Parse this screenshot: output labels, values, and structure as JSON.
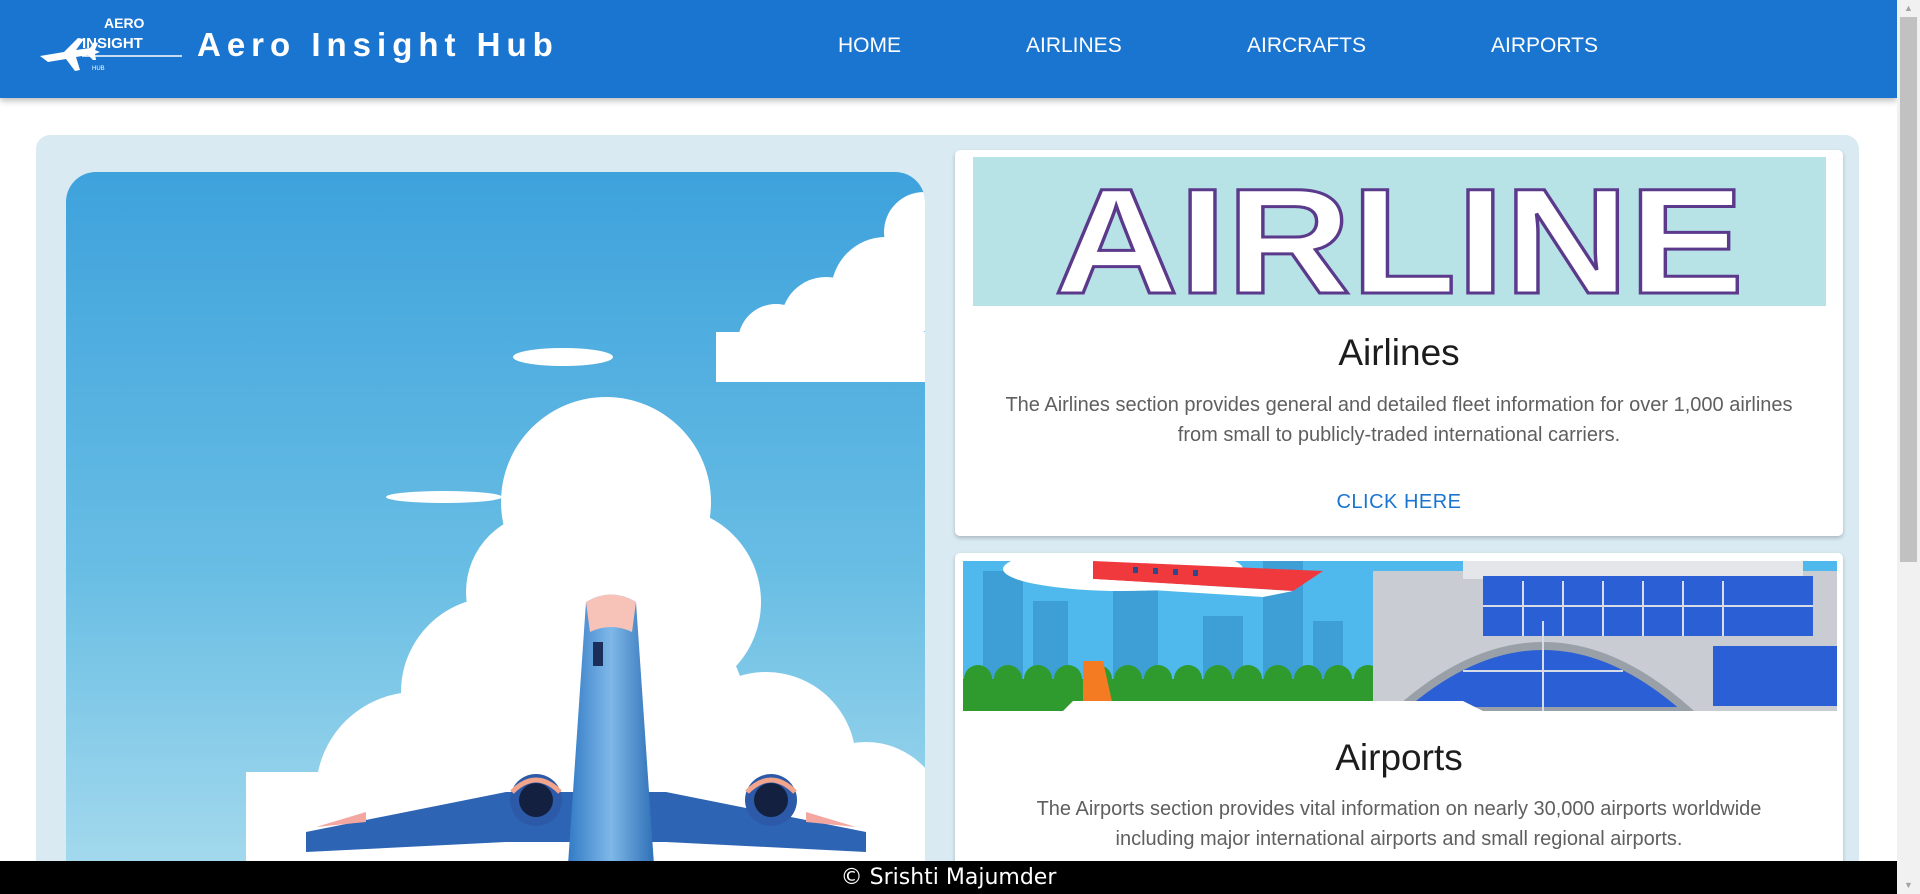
{
  "header": {
    "logo_text": {
      "line1": "AERO",
      "line2": "INSIGHT",
      "line3": "HUB"
    },
    "brand": "Aero Insight Hub",
    "nav": [
      {
        "label": "HOME"
      },
      {
        "label": "AIRLINES"
      },
      {
        "label": "AIRCRAFTS"
      },
      {
        "label": "AIRPORTS"
      }
    ]
  },
  "cards": [
    {
      "banner_text": "AIRLINE",
      "title": "Airlines",
      "description": "The Airlines section provides general and detailed fleet information for over 1,000 airlines from small to publicly-traded international carriers.",
      "link": "CLICK HERE"
    },
    {
      "title": "Airports",
      "description": "The Airports section provides vital information on nearly 30,000 airports worldwide including major international airports and small regional airports."
    }
  ],
  "footer": {
    "text": "© Srishti Majumder"
  },
  "colors": {
    "header_bg": "#1a75d1",
    "panel_bg": "#d9eaf3",
    "link": "#1a75d1",
    "footer_bg": "#000000"
  },
  "icons": [
    "airplane-logo-icon",
    "scroll-up-icon",
    "scroll-down-icon"
  ]
}
